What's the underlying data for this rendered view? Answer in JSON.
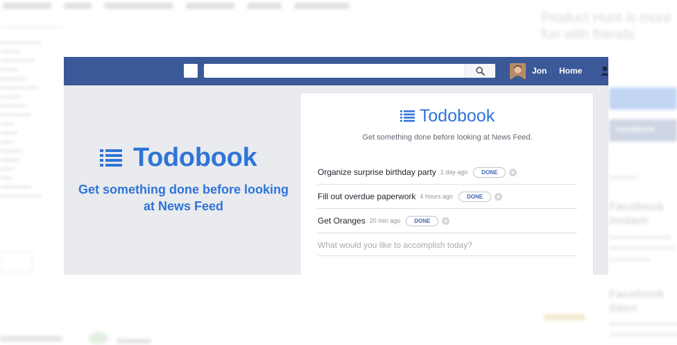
{
  "background": {
    "right_title": "Product Hunt is more fun with friends",
    "right_button_1": "",
    "right_button_2": "FACEBOOK",
    "right_heading_1": "Facebook Instant",
    "right_heading_2": "Facebook Seen",
    "bottom_label_1": "",
    "bottom_label_2": ""
  },
  "facebook_bar": {
    "search_placeholder": "",
    "user_name": "Jon",
    "home_label": "Home",
    "icons": {
      "logo": "facebook-logo-icon",
      "search": "search-icon",
      "friends": "friend-requests-icon"
    },
    "colors": {
      "bar": "#3b5998"
    }
  },
  "hero": {
    "logo_text": "Todobook",
    "tagline": "Get something done before looking at News Feed",
    "icon": "list-icon",
    "accent_color": "#2f74d8"
  },
  "card": {
    "logo_text": "Todobook",
    "subtitle": "Get something done before looking at News Feed.",
    "todos": [
      {
        "text": "Organize surprise birthday party",
        "time": "1 day ago",
        "action": "DONE"
      },
      {
        "text": "Fill out overdue paperwork",
        "time": "4 hours ago",
        "action": "DONE"
      },
      {
        "text": "Get Oranges",
        "time": "20 min ago",
        "action": "DONE"
      }
    ],
    "input_placeholder": "What would you like to accomplish today?"
  }
}
